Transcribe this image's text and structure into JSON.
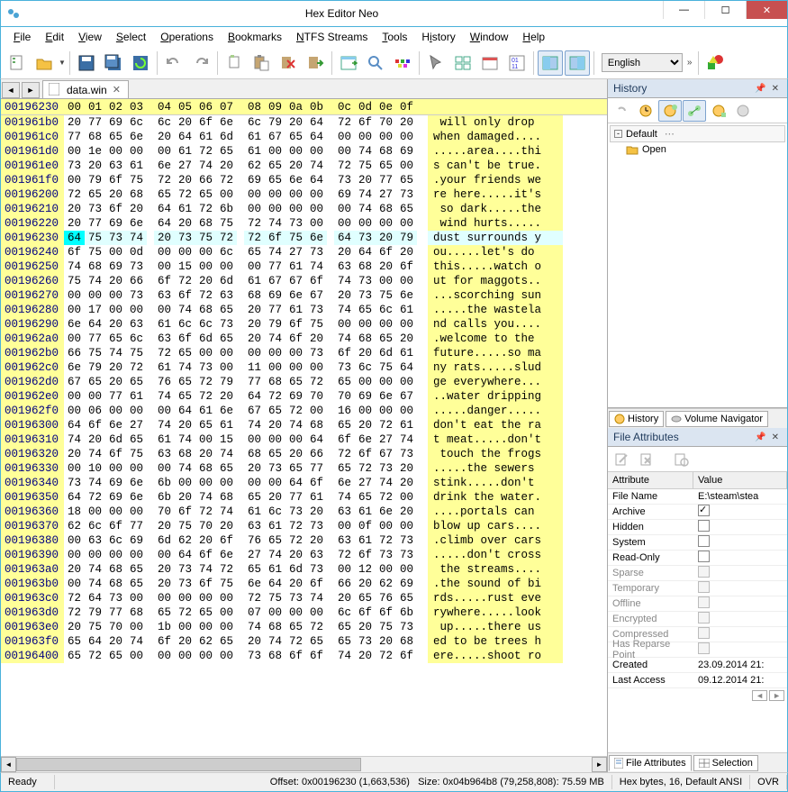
{
  "window": {
    "title": "Hex Editor Neo"
  },
  "menu": [
    "File",
    "Edit",
    "View",
    "Select",
    "Operations",
    "Bookmarks",
    "NTFS Streams",
    "Tools",
    "History",
    "Window",
    "Help"
  ],
  "language": "English",
  "tab": {
    "name": "data.win"
  },
  "hex_header_offset": "00196230",
  "hex_cols": [
    "00",
    "01",
    "02",
    "03",
    "04",
    "05",
    "06",
    "07",
    "08",
    "09",
    "0a",
    "0b",
    "0c",
    "0d",
    "0e",
    "0f"
  ],
  "rows": [
    {
      "o": "001961b0",
      "b": [
        "20",
        "77",
        "69",
        "6c",
        "6c",
        "20",
        "6f",
        "6e",
        "6c",
        "79",
        "20",
        "64",
        "72",
        "6f",
        "70",
        "20"
      ],
      "a": " will only drop "
    },
    {
      "o": "001961c0",
      "b": [
        "77",
        "68",
        "65",
        "6e",
        "20",
        "64",
        "61",
        "6d",
        "61",
        "67",
        "65",
        "64",
        "00",
        "00",
        "00",
        "00"
      ],
      "a": "when damaged...."
    },
    {
      "o": "001961d0",
      "b": [
        "00",
        "1e",
        "00",
        "00",
        "00",
        "61",
        "72",
        "65",
        "61",
        "00",
        "00",
        "00",
        "00",
        "74",
        "68",
        "69"
      ],
      "a": ".....area....thi"
    },
    {
      "o": "001961e0",
      "b": [
        "73",
        "20",
        "63",
        "61",
        "6e",
        "27",
        "74",
        "20",
        "62",
        "65",
        "20",
        "74",
        "72",
        "75",
        "65",
        "00"
      ],
      "a": "s can't be true."
    },
    {
      "o": "001961f0",
      "b": [
        "00",
        "79",
        "6f",
        "75",
        "72",
        "20",
        "66",
        "72",
        "69",
        "65",
        "6e",
        "64",
        "73",
        "20",
        "77",
        "65"
      ],
      "a": ".your friends we"
    },
    {
      "o": "00196200",
      "b": [
        "72",
        "65",
        "20",
        "68",
        "65",
        "72",
        "65",
        "00",
        "00",
        "00",
        "00",
        "00",
        "69",
        "74",
        "27",
        "73"
      ],
      "a": "re here.....it's"
    },
    {
      "o": "00196210",
      "b": [
        "20",
        "73",
        "6f",
        "20",
        "64",
        "61",
        "72",
        "6b",
        "00",
        "00",
        "00",
        "00",
        "00",
        "74",
        "68",
        "65"
      ],
      "a": " so dark.....the"
    },
    {
      "o": "00196220",
      "b": [
        "20",
        "77",
        "69",
        "6e",
        "64",
        "20",
        "68",
        "75",
        "72",
        "74",
        "73",
        "00",
        "00",
        "00",
        "00",
        "00"
      ],
      "a": " wind hurts....."
    },
    {
      "o": "00196230",
      "b": [
        "64",
        "75",
        "73",
        "74",
        "20",
        "73",
        "75",
        "72",
        "72",
        "6f",
        "75",
        "6e",
        "64",
        "73",
        "20",
        "79"
      ],
      "a": "dust surrounds y",
      "hl": 1
    },
    {
      "o": "00196240",
      "b": [
        "6f",
        "75",
        "00",
        "0d",
        "00",
        "00",
        "00",
        "6c",
        "65",
        "74",
        "27",
        "73",
        "20",
        "64",
        "6f",
        "20"
      ],
      "a": "ou.....let's do "
    },
    {
      "o": "00196250",
      "b": [
        "74",
        "68",
        "69",
        "73",
        "00",
        "15",
        "00",
        "00",
        "00",
        "77",
        "61",
        "74",
        "63",
        "68",
        "20",
        "6f"
      ],
      "a": "this.....watch o"
    },
    {
      "o": "00196260",
      "b": [
        "75",
        "74",
        "20",
        "66",
        "6f",
        "72",
        "20",
        "6d",
        "61",
        "67",
        "67",
        "6f",
        "74",
        "73",
        "00",
        "00"
      ],
      "a": "ut for maggots.."
    },
    {
      "o": "00196270",
      "b": [
        "00",
        "00",
        "00",
        "73",
        "63",
        "6f",
        "72",
        "63",
        "68",
        "69",
        "6e",
        "67",
        "20",
        "73",
        "75",
        "6e"
      ],
      "a": "...scorching sun"
    },
    {
      "o": "00196280",
      "b": [
        "00",
        "17",
        "00",
        "00",
        "00",
        "74",
        "68",
        "65",
        "20",
        "77",
        "61",
        "73",
        "74",
        "65",
        "6c",
        "61"
      ],
      "a": ".....the wastela"
    },
    {
      "o": "00196290",
      "b": [
        "6e",
        "64",
        "20",
        "63",
        "61",
        "6c",
        "6c",
        "73",
        "20",
        "79",
        "6f",
        "75",
        "00",
        "00",
        "00",
        "00"
      ],
      "a": "nd calls you...."
    },
    {
      "o": "001962a0",
      "b": [
        "00",
        "77",
        "65",
        "6c",
        "63",
        "6f",
        "6d",
        "65",
        "20",
        "74",
        "6f",
        "20",
        "74",
        "68",
        "65",
        "20"
      ],
      "a": ".welcome to the "
    },
    {
      "o": "001962b0",
      "b": [
        "66",
        "75",
        "74",
        "75",
        "72",
        "65",
        "00",
        "00",
        "00",
        "00",
        "00",
        "73",
        "6f",
        "20",
        "6d",
        "61"
      ],
      "a": "future.....so ma"
    },
    {
      "o": "001962c0",
      "b": [
        "6e",
        "79",
        "20",
        "72",
        "61",
        "74",
        "73",
        "00",
        "11",
        "00",
        "00",
        "00",
        "73",
        "6c",
        "75",
        "64"
      ],
      "a": "ny rats.....slud"
    },
    {
      "o": "001962d0",
      "b": [
        "67",
        "65",
        "20",
        "65",
        "76",
        "65",
        "72",
        "79",
        "77",
        "68",
        "65",
        "72",
        "65",
        "00",
        "00",
        "00"
      ],
      "a": "ge everywhere..."
    },
    {
      "o": "001962e0",
      "b": [
        "00",
        "00",
        "77",
        "61",
        "74",
        "65",
        "72",
        "20",
        "64",
        "72",
        "69",
        "70",
        "70",
        "69",
        "6e",
        "67"
      ],
      "a": "..water dripping"
    },
    {
      "o": "001962f0",
      "b": [
        "00",
        "06",
        "00",
        "00",
        "00",
        "64",
        "61",
        "6e",
        "67",
        "65",
        "72",
        "00",
        "16",
        "00",
        "00",
        "00"
      ],
      "a": ".....danger....."
    },
    {
      "o": "00196300",
      "b": [
        "64",
        "6f",
        "6e",
        "27",
        "74",
        "20",
        "65",
        "61",
        "74",
        "20",
        "74",
        "68",
        "65",
        "20",
        "72",
        "61"
      ],
      "a": "don't eat the ra"
    },
    {
      "o": "00196310",
      "b": [
        "74",
        "20",
        "6d",
        "65",
        "61",
        "74",
        "00",
        "15",
        "00",
        "00",
        "00",
        "64",
        "6f",
        "6e",
        "27",
        "74"
      ],
      "a": "t meat.....don't"
    },
    {
      "o": "00196320",
      "b": [
        "20",
        "74",
        "6f",
        "75",
        "63",
        "68",
        "20",
        "74",
        "68",
        "65",
        "20",
        "66",
        "72",
        "6f",
        "67",
        "73"
      ],
      "a": " touch the frogs"
    },
    {
      "o": "00196330",
      "b": [
        "00",
        "10",
        "00",
        "00",
        "00",
        "74",
        "68",
        "65",
        "20",
        "73",
        "65",
        "77",
        "65",
        "72",
        "73",
        "20"
      ],
      "a": ".....the sewers "
    },
    {
      "o": "00196340",
      "b": [
        "73",
        "74",
        "69",
        "6e",
        "6b",
        "00",
        "00",
        "00",
        "00",
        "00",
        "64",
        "6f",
        "6e",
        "27",
        "74",
        "20"
      ],
      "a": "stink.....don't "
    },
    {
      "o": "00196350",
      "b": [
        "64",
        "72",
        "69",
        "6e",
        "6b",
        "20",
        "74",
        "68",
        "65",
        "20",
        "77",
        "61",
        "74",
        "65",
        "72",
        "00"
      ],
      "a": "drink the water."
    },
    {
      "o": "00196360",
      "b": [
        "18",
        "00",
        "00",
        "00",
        "70",
        "6f",
        "72",
        "74",
        "61",
        "6c",
        "73",
        "20",
        "63",
        "61",
        "6e",
        "20"
      ],
      "a": "....portals can "
    },
    {
      "o": "00196370",
      "b": [
        "62",
        "6c",
        "6f",
        "77",
        "20",
        "75",
        "70",
        "20",
        "63",
        "61",
        "72",
        "73",
        "00",
        "0f",
        "00",
        "00"
      ],
      "a": "blow up cars...."
    },
    {
      "o": "00196380",
      "b": [
        "00",
        "63",
        "6c",
        "69",
        "6d",
        "62",
        "20",
        "6f",
        "76",
        "65",
        "72",
        "20",
        "63",
        "61",
        "72",
        "73"
      ],
      "a": ".climb over cars"
    },
    {
      "o": "00196390",
      "b": [
        "00",
        "00",
        "00",
        "00",
        "00",
        "64",
        "6f",
        "6e",
        "27",
        "74",
        "20",
        "63",
        "72",
        "6f",
        "73",
        "73"
      ],
      "a": ".....don't cross"
    },
    {
      "o": "001963a0",
      "b": [
        "20",
        "74",
        "68",
        "65",
        "20",
        "73",
        "74",
        "72",
        "65",
        "61",
        "6d",
        "73",
        "00",
        "12",
        "00",
        "00"
      ],
      "a": " the streams...."
    },
    {
      "o": "001963b0",
      "b": [
        "00",
        "74",
        "68",
        "65",
        "20",
        "73",
        "6f",
        "75",
        "6e",
        "64",
        "20",
        "6f",
        "66",
        "20",
        "62",
        "69"
      ],
      "a": ".the sound of bi"
    },
    {
      "o": "001963c0",
      "b": [
        "72",
        "64",
        "73",
        "00",
        "00",
        "00",
        "00",
        "00",
        "72",
        "75",
        "73",
        "74",
        "20",
        "65",
        "76",
        "65"
      ],
      "a": "rds.....rust eve"
    },
    {
      "o": "001963d0",
      "b": [
        "72",
        "79",
        "77",
        "68",
        "65",
        "72",
        "65",
        "00",
        "07",
        "00",
        "00",
        "00",
        "6c",
        "6f",
        "6f",
        "6b"
      ],
      "a": "rywhere.....look"
    },
    {
      "o": "001963e0",
      "b": [
        "20",
        "75",
        "70",
        "00",
        "1b",
        "00",
        "00",
        "00",
        "74",
        "68",
        "65",
        "72",
        "65",
        "20",
        "75",
        "73"
      ],
      "a": " up.....there us"
    },
    {
      "o": "001963f0",
      "b": [
        "65",
        "64",
        "20",
        "74",
        "6f",
        "20",
        "62",
        "65",
        "20",
        "74",
        "72",
        "65",
        "65",
        "73",
        "20",
        "68"
      ],
      "a": "ed to be trees h"
    },
    {
      "o": "00196400",
      "b": [
        "65",
        "72",
        "65",
        "00",
        "00",
        "00",
        "00",
        "00",
        "73",
        "68",
        "6f",
        "6f",
        "74",
        "20",
        "72",
        "6f"
      ],
      "a": "ere.....shoot ro"
    }
  ],
  "history_panel": {
    "title": "History",
    "default": "Default",
    "open": "Open"
  },
  "history_tabs": {
    "history": "History",
    "volnav": "Volume Navigator"
  },
  "attr_panel": {
    "title": "File Attributes",
    "hdr_attr": "Attribute",
    "hdr_val": "Value",
    "items": [
      {
        "name": "File Name",
        "val": "E:\\steam\\stea"
      },
      {
        "name": "Archive",
        "cb": true,
        "checked": true
      },
      {
        "name": "Hidden",
        "cb": true,
        "checked": false
      },
      {
        "name": "System",
        "cb": true,
        "checked": false
      },
      {
        "name": "Read-Only",
        "cb": true,
        "checked": false
      },
      {
        "name": "Sparse",
        "cb": true,
        "dim": true
      },
      {
        "name": "Temporary",
        "cb": true,
        "dim": true
      },
      {
        "name": "Offline",
        "cb": true,
        "dim": true
      },
      {
        "name": "Encrypted",
        "cb": true,
        "dim": true
      },
      {
        "name": "Compressed",
        "cb": true,
        "dim": true
      },
      {
        "name": "Has Reparse Point",
        "cb": true,
        "dim": true
      },
      {
        "name": "Created",
        "val": "23.09.2014 21:"
      },
      {
        "name": "Last Access",
        "val": "09.12.2014 21:"
      }
    ]
  },
  "attr_tabs": {
    "fa": "File Attributes",
    "sel": "Selection"
  },
  "status": {
    "ready": "Ready",
    "offset": "Offset: 0x00196230 (1,663,536)",
    "size": "Size: 0x04b964b8 (79,258,808): 75.59 MB",
    "enc": "Hex bytes, 16, Default ANSI",
    "ovr": "OVR"
  }
}
